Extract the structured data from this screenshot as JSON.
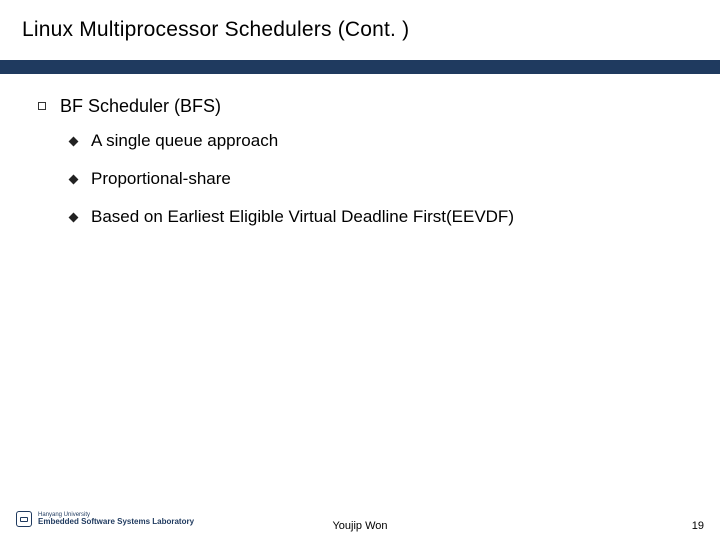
{
  "slide": {
    "title": "Linux Multiprocessor Schedulers (Cont. )",
    "section": "BF Scheduler (BFS)",
    "bullets": [
      "A single queue approach",
      "Proportional-share",
      "Based on Earliest Eligible Virtual Deadline First(EEVDF)"
    ]
  },
  "footer": {
    "university": "Hanyang University",
    "lab": "Embedded Software Systems Laboratory",
    "author": "Youjip Won",
    "page": "19"
  }
}
